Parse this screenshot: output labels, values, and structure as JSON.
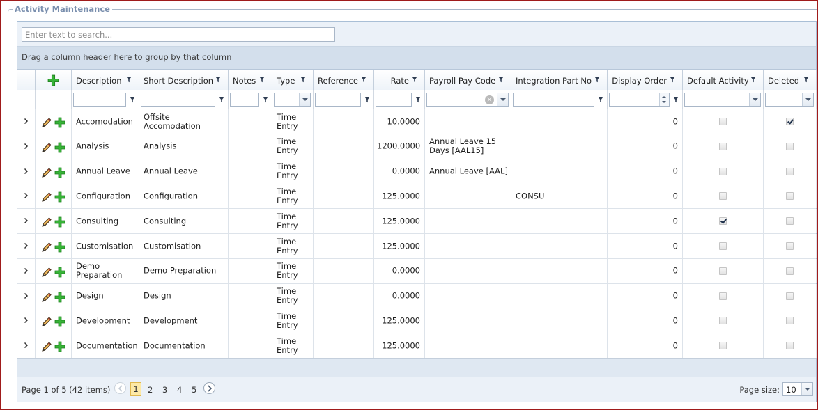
{
  "panel": {
    "title": "Activity Maintenance"
  },
  "search": {
    "placeholder": "Enter text to search..."
  },
  "group_panel": {
    "text": "Drag a column header here to group by that column"
  },
  "columns": [
    {
      "key": "description",
      "label": "Description"
    },
    {
      "key": "short_description",
      "label": "Short Description"
    },
    {
      "key": "notes",
      "label": "Notes"
    },
    {
      "key": "type",
      "label": "Type"
    },
    {
      "key": "reference",
      "label": "Reference"
    },
    {
      "key": "rate",
      "label": "Rate"
    },
    {
      "key": "payroll_pay_code",
      "label": "Payroll Pay Code"
    },
    {
      "key": "integration_part_no",
      "label": "Integration Part No"
    },
    {
      "key": "display_order",
      "label": "Display Order"
    },
    {
      "key": "default_activity",
      "label": "Default Activity"
    },
    {
      "key": "deleted",
      "label": "Deleted"
    }
  ],
  "rows": [
    {
      "description": "Accomodation",
      "short_description": "Offsite Accomodation",
      "notes": "",
      "type": "Time Entry",
      "reference": "",
      "rate": "10.0000",
      "payroll_pay_code": "",
      "integration_part_no": "",
      "display_order": "0",
      "default_activity": false,
      "deleted": true
    },
    {
      "description": "Analysis",
      "short_description": "Analysis",
      "notes": "",
      "type": "Time Entry",
      "reference": "",
      "rate": "1200.0000",
      "payroll_pay_code": "Annual Leave 15 Days [AAL15]",
      "integration_part_no": "",
      "display_order": "0",
      "default_activity": false,
      "deleted": false
    },
    {
      "description": "Annual Leave",
      "short_description": "Annual Leave",
      "notes": "",
      "type": "Time Entry",
      "reference": "",
      "rate": "0.0000",
      "payroll_pay_code": "Annual Leave [AAL]",
      "integration_part_no": "",
      "display_order": "0",
      "default_activity": false,
      "deleted": false
    },
    {
      "description": "Configuration",
      "short_description": "Configuration",
      "notes": "",
      "type": "Time Entry",
      "reference": "",
      "rate": "125.0000",
      "payroll_pay_code": "",
      "integration_part_no": "CONSU",
      "display_order": "0",
      "default_activity": false,
      "deleted": false
    },
    {
      "description": "Consulting",
      "short_description": "Consulting",
      "notes": "",
      "type": "Time Entry",
      "reference": "",
      "rate": "125.0000",
      "payroll_pay_code": "",
      "integration_part_no": "",
      "display_order": "0",
      "default_activity": true,
      "deleted": false
    },
    {
      "description": "Customisation",
      "short_description": "Customisation",
      "notes": "",
      "type": "Time Entry",
      "reference": "",
      "rate": "125.0000",
      "payroll_pay_code": "",
      "integration_part_no": "",
      "display_order": "0",
      "default_activity": false,
      "deleted": false
    },
    {
      "description": "Demo Preparation",
      "short_description": "Demo Preparation",
      "notes": "",
      "type": "Time Entry",
      "reference": "",
      "rate": "0.0000",
      "payroll_pay_code": "",
      "integration_part_no": "",
      "display_order": "0",
      "default_activity": false,
      "deleted": false
    },
    {
      "description": "Design",
      "short_description": "Design",
      "notes": "",
      "type": "Time Entry",
      "reference": "",
      "rate": "0.0000",
      "payroll_pay_code": "",
      "integration_part_no": "",
      "display_order": "0",
      "default_activity": false,
      "deleted": false
    },
    {
      "description": "Development",
      "short_description": "Development",
      "notes": "",
      "type": "Time Entry",
      "reference": "",
      "rate": "125.0000",
      "payroll_pay_code": "",
      "integration_part_no": "",
      "display_order": "0",
      "default_activity": false,
      "deleted": false
    },
    {
      "description": "Documentation",
      "short_description": "Documentation",
      "notes": "",
      "type": "Time Entry",
      "reference": "",
      "rate": "125.0000",
      "payroll_pay_code": "",
      "integration_part_no": "",
      "display_order": "0",
      "default_activity": false,
      "deleted": false
    }
  ],
  "pager": {
    "summary": "Page 1 of 5 (42 items)",
    "pages": [
      "1",
      "2",
      "3",
      "4",
      "5"
    ],
    "current_page": "1",
    "page_size_label": "Page size:",
    "page_size": "10"
  },
  "icons": {
    "expander": "chevron-right-icon",
    "edit": "pencil-icon",
    "add": "plus-icon",
    "filter": "funnel-icon"
  },
  "colors": {
    "frame_border": "#a01b1b",
    "header_bg": "#ebf1f8",
    "group_panel_bg": "#d3dfec",
    "add_icon": "#2ea82e",
    "current_page_bg": "#fde9a6"
  }
}
